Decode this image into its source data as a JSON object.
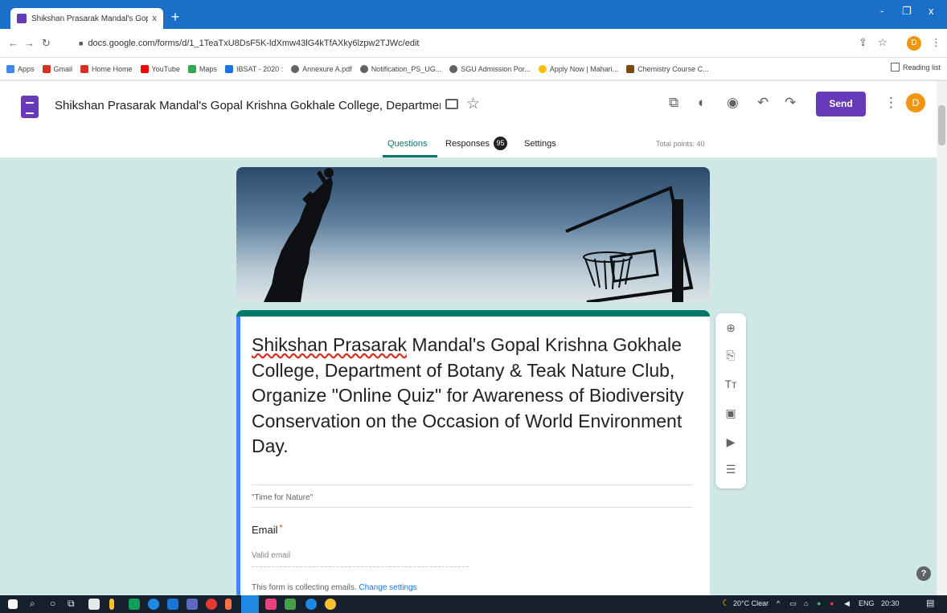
{
  "browser": {
    "tab_title": "Shikshan Prasarak Mandal's Gop",
    "tab_close": "x",
    "new_tab": "+",
    "url": "docs.google.com/forms/d/1_1TeaTxU8DsF5K-ldXmw43lG4kTfAXky6lzpw2TJWc/edit",
    "win_controls": [
      "-",
      "❐",
      "x"
    ]
  },
  "bookmarks": {
    "items": [
      {
        "label": "Apps",
        "color": "#4285f4"
      },
      {
        "label": "Gmail",
        "color": "#d93025"
      },
      {
        "label": "Home Home",
        "color": "#d93025"
      },
      {
        "label": "YouTube",
        "color": "#ff0000"
      },
      {
        "label": "Maps",
        "color": "#34a853"
      },
      {
        "label": "IBSAT - 2020 :",
        "color": "#1a73e8"
      },
      {
        "label": "Annexure A.pdf",
        "color": "#5f6368"
      },
      {
        "label": "Notification_PS_UG...",
        "color": "#5f6368"
      },
      {
        "label": "SGU Admission Por...",
        "color": "#5f6368"
      },
      {
        "label": "Apply Now | Mahari...",
        "color": "#fbbc04"
      },
      {
        "label": "Chemistry Course C...",
        "color": "#7b4a12"
      }
    ],
    "reading_list": "Reading list"
  },
  "form_header": {
    "title": "Shikshan Prasarak Mandal's Gopal Krishna Gokhale College, Department o",
    "send_label": "Send",
    "avatar_initial": "D",
    "tabs": {
      "questions": "Questions",
      "responses": "Responses",
      "responses_count": "95",
      "settings": "Settings"
    },
    "total_points": "Total points: 40"
  },
  "form_card": {
    "title_underlined_part": "Shikshan Prasarak",
    "title_rest": " Mandal's Gopal Krishna Gokhale College, Department of Botany & Teak Nature Club, Organize \"Online Quiz\" for Awareness of Biodiversity Conservation on the Occasion of World Environment Day.",
    "description": "\"Time for Nature\"",
    "email_label": "Email",
    "email_required": "*",
    "email_placeholder": "Valid email",
    "collecting_text": "This form is collecting emails.",
    "change_settings": "Change settings"
  },
  "taskbar": {
    "weather": "20°C Clear",
    "lang": "ENG",
    "time": "20:30"
  },
  "colors": {
    "accent_purple": "#673ab7",
    "accent_teal": "#00796b",
    "background": "#cfe8e6"
  }
}
